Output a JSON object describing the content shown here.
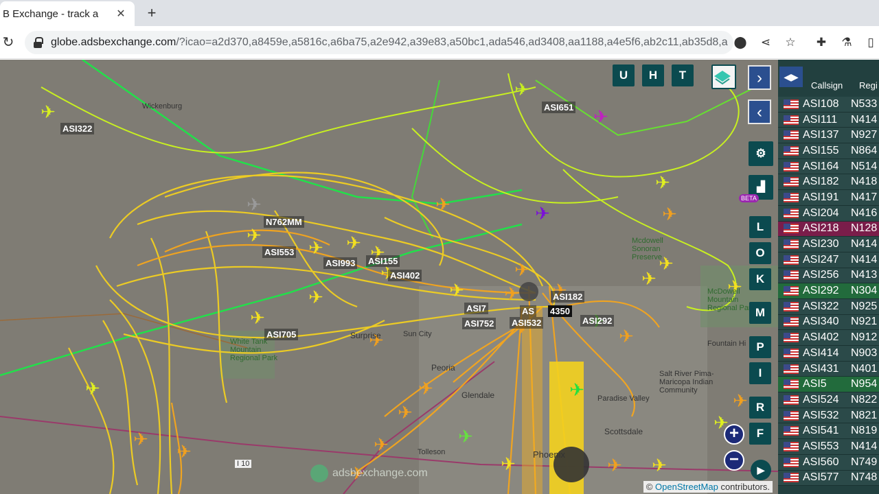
{
  "browser": {
    "tab_title": "B Exchange - track a",
    "url_host": "globe.adsbexchange.com",
    "url_rest": "/?icao=a2d370,a8459e,a5816c,a6ba75,a2e942,a39e83,a50bc1,ada546,ad3408,aa1188,a4e5f6,ab2c11,ab35d8,a..."
  },
  "map": {
    "aircraft_labels": [
      "ASI322",
      "ASI651",
      "N762MM",
      "ASI553",
      "ASI993",
      "ASI155",
      "ASI402",
      "ASI705",
      "ASI7",
      "ASI752",
      "AS",
      "ASI532",
      "ASI182",
      "4350",
      "ASI292"
    ],
    "places": [
      "Wickenburg",
      "Surprise",
      "Sun City",
      "Peoria",
      "Glendale",
      "Phoenix",
      "Tolleson",
      "Scottsdale",
      "Paradise Valley",
      "Fountain Hi",
      "Salt River Pima-Maricopa Indian Community",
      "White Tank Mountain Regional Park",
      "Mcdowell Sonoran Preserve",
      "McDowell Mountain Regional Park",
      "I 10"
    ],
    "controls": {
      "u": "U",
      "h": "H",
      "t": "T",
      "l": "L",
      "o": "O",
      "k": "K",
      "m": "M",
      "p": "P",
      "i": "I",
      "r": "R",
      "f": "F",
      "beta": "BETA",
      "zoom_in": "+",
      "zoom_out": "−"
    },
    "watermark": "adsbexchange.com",
    "attribution_prefix": "©",
    "attribution_link": "OpenStreetMap",
    "attribution_suffix": "contributors."
  },
  "panel": {
    "col_callsign": "Callsign",
    "col_reg": "Regi",
    "rows": [
      {
        "callsign": "ASI108",
        "reg": "N533"
      },
      {
        "callsign": "ASI111",
        "reg": "N414"
      },
      {
        "callsign": "ASI137",
        "reg": "N927"
      },
      {
        "callsign": "ASI155",
        "reg": "N864"
      },
      {
        "callsign": "ASI164",
        "reg": "N514"
      },
      {
        "callsign": "ASI182",
        "reg": "N418"
      },
      {
        "callsign": "ASI191",
        "reg": "N417"
      },
      {
        "callsign": "ASI204",
        "reg": "N416"
      },
      {
        "callsign": "ASI218",
        "reg": "N128"
      },
      {
        "callsign": "ASI230",
        "reg": "N414"
      },
      {
        "callsign": "ASI247",
        "reg": "N414"
      },
      {
        "callsign": "ASI256",
        "reg": "N413"
      },
      {
        "callsign": "ASI292",
        "reg": "N304"
      },
      {
        "callsign": "ASI322",
        "reg": "N925"
      },
      {
        "callsign": "ASI340",
        "reg": "N921"
      },
      {
        "callsign": "ASI402",
        "reg": "N912"
      },
      {
        "callsign": "ASI414",
        "reg": "N903"
      },
      {
        "callsign": "ASI431",
        "reg": "N401"
      },
      {
        "callsign": "ASI5",
        "reg": "N954"
      },
      {
        "callsign": "ASI524",
        "reg": "N822"
      },
      {
        "callsign": "ASI532",
        "reg": "N821"
      },
      {
        "callsign": "ASI541",
        "reg": "N819"
      },
      {
        "callsign": "ASI553",
        "reg": "N414"
      },
      {
        "callsign": "ASI560",
        "reg": "N749"
      },
      {
        "callsign": "ASI577",
        "reg": "N748"
      }
    ]
  },
  "colors": {
    "row_selected_red": "#7a1d4a",
    "row_selected_green": "#226b3c",
    "panel_bg": "#22403f",
    "control_bg": "#0b4a4f"
  }
}
